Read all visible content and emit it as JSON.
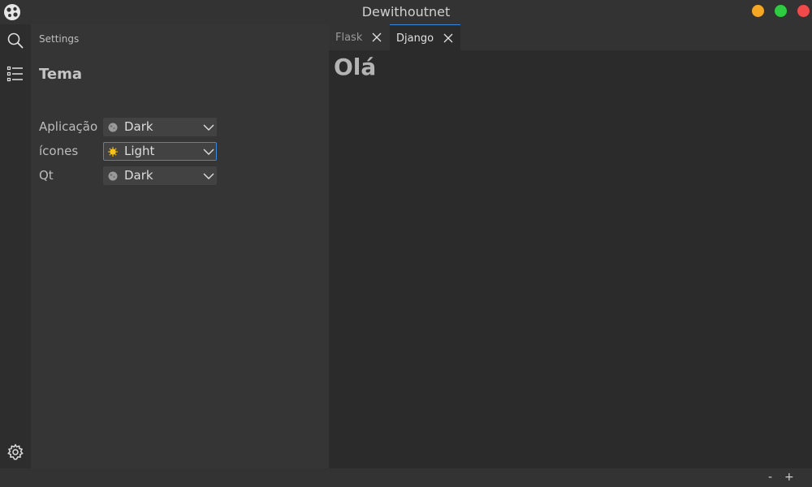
{
  "window": {
    "title": "Dewithoutnet"
  },
  "activity_bar": {
    "icons": [
      "search-icon",
      "list-icon",
      "settings-icon"
    ]
  },
  "sidebar": {
    "header": "Settings",
    "section_title": "Tema",
    "settings": [
      {
        "label": "Aplicação",
        "value": "Dark",
        "icon": "moon-icon"
      },
      {
        "label": "ícones",
        "value": "Light",
        "icon": "sun-icon"
      },
      {
        "label": "Qt",
        "value": "Dark",
        "icon": "moon-icon"
      }
    ]
  },
  "tabs": [
    {
      "label": "Flask",
      "active": false
    },
    {
      "label": "Django",
      "active": true
    }
  ],
  "editor": {
    "heading": "Olá"
  },
  "statusbar": {
    "zoom_out": "-",
    "zoom_in": "+"
  },
  "colors": {
    "accent": "#3a86d8",
    "minimize": "#f5a623",
    "maximize": "#2ecc40",
    "close": "#f04a4a"
  }
}
